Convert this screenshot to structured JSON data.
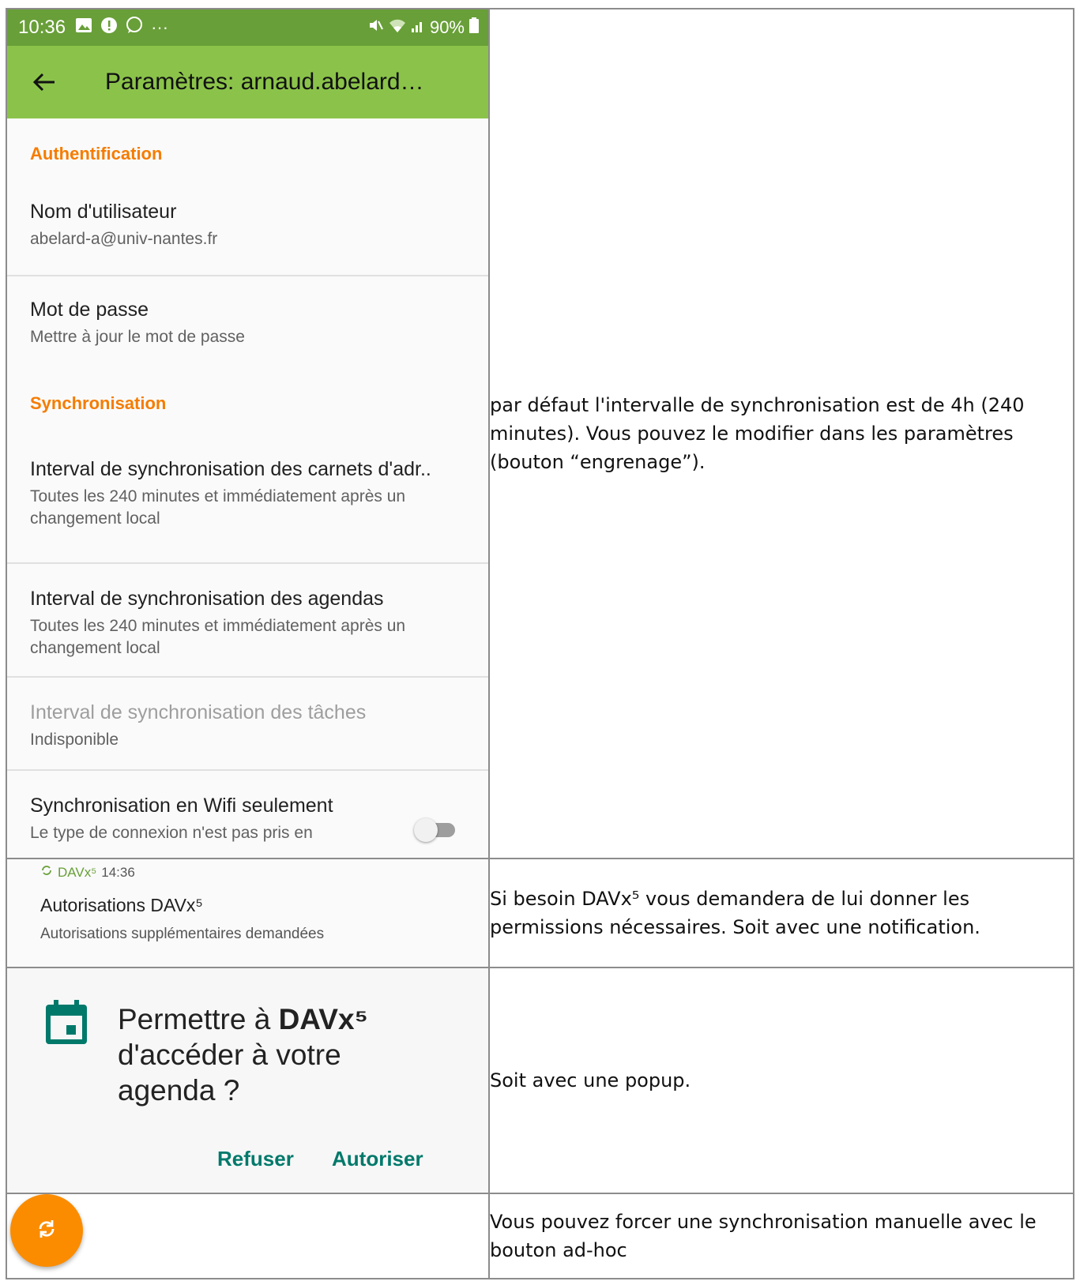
{
  "rows": [
    {
      "phone": {
        "status_bar": {
          "time": "10:36",
          "dots": "···",
          "battery": "90%"
        },
        "toolbar": {
          "title": "Paramètres: arnaud.abelard…"
        },
        "sections": {
          "auth_header": "Authentification",
          "username_title": "Nom d'utilisateur",
          "username_value": "abelard-a@univ-nantes.fr",
          "password_title": "Mot de passe",
          "password_summary": "Mettre à jour le mot de passe",
          "sync_header": "Synchronisation",
          "contacts_interval_title": "Interval de synchronisation des carnets d'adr..",
          "contacts_interval_summary": "Toutes les 240 minutes et immédiatement après un changement local",
          "calendars_interval_title": "Interval de synchronisation des agendas",
          "calendars_interval_summary": "Toutes les 240 minutes et immédiatement après un changement local",
          "tasks_interval_title": "Interval de synchronisation des tâches",
          "tasks_interval_summary": "Indisponible",
          "wifi_only_title": "Synchronisation en Wifi seulement",
          "wifi_only_summary": "Le type de connexion n'est pas pris en",
          "wifi_only_enabled": false
        }
      },
      "text": "par défaut l'intervalle de synchronisation est de 4h (240 minutes). Vous pouvez le modifier dans les paramètres (bouton “engrenage”)."
    },
    {
      "notification": {
        "app": "DAVx⁵",
        "time": "14:36",
        "title": "Autorisations DAVx⁵",
        "text": "Autorisations supplémentaires demandées"
      },
      "text": "Si besoin DAVx⁵ vous demandera de lui donner les permissions nécessaires. Soit avec une notification."
    },
    {
      "dialog": {
        "line1_prefix": "Permettre à ",
        "app": "DAVx⁵",
        "line2": "d'accéder à votre",
        "line3": "agenda ?",
        "deny": "Refuser",
        "allow": "Autoriser"
      },
      "text": "Soit avec une popup."
    },
    {
      "text": "Vous pouvez forcer une synchronisation manuelle avec le bouton ad-hoc"
    }
  ],
  "colors": {
    "status_bar": "#689f38",
    "toolbar": "#8bc34a",
    "section_header": "#f57c00",
    "dialog_accent": "#00796b",
    "fab": "#fb8c00"
  },
  "icons": [
    "back-arrow-icon",
    "gallery-icon",
    "alert-icon",
    "whatsapp-icon",
    "mute-icon",
    "wifi-icon",
    "signal-icon",
    "battery-icon",
    "sync-icon",
    "calendar-icon"
  ]
}
